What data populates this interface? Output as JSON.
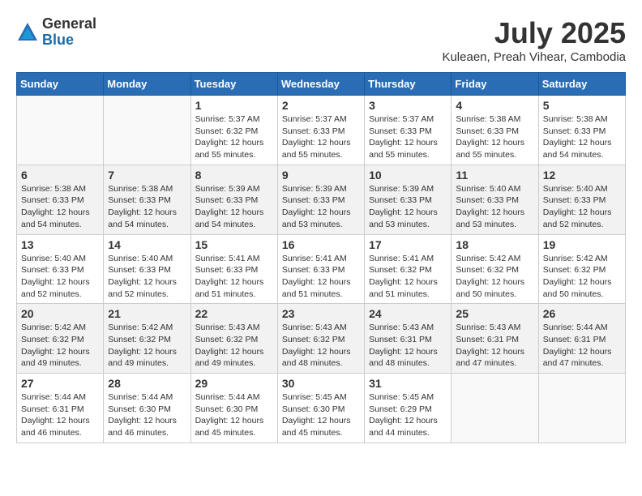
{
  "logo": {
    "general": "General",
    "blue": "Blue"
  },
  "title": "July 2025",
  "subtitle": "Kuleaen, Preah Vihear, Cambodia",
  "days_of_week": [
    "Sunday",
    "Monday",
    "Tuesday",
    "Wednesday",
    "Thursday",
    "Friday",
    "Saturday"
  ],
  "weeks": [
    [
      {
        "day": "",
        "info": ""
      },
      {
        "day": "",
        "info": ""
      },
      {
        "day": "1",
        "info": "Sunrise: 5:37 AM\nSunset: 6:32 PM\nDaylight: 12 hours\nand 55 minutes."
      },
      {
        "day": "2",
        "info": "Sunrise: 5:37 AM\nSunset: 6:33 PM\nDaylight: 12 hours\nand 55 minutes."
      },
      {
        "day": "3",
        "info": "Sunrise: 5:37 AM\nSunset: 6:33 PM\nDaylight: 12 hours\nand 55 minutes."
      },
      {
        "day": "4",
        "info": "Sunrise: 5:38 AM\nSunset: 6:33 PM\nDaylight: 12 hours\nand 55 minutes."
      },
      {
        "day": "5",
        "info": "Sunrise: 5:38 AM\nSunset: 6:33 PM\nDaylight: 12 hours\nand 54 minutes."
      }
    ],
    [
      {
        "day": "6",
        "info": "Sunrise: 5:38 AM\nSunset: 6:33 PM\nDaylight: 12 hours\nand 54 minutes."
      },
      {
        "day": "7",
        "info": "Sunrise: 5:38 AM\nSunset: 6:33 PM\nDaylight: 12 hours\nand 54 minutes."
      },
      {
        "day": "8",
        "info": "Sunrise: 5:39 AM\nSunset: 6:33 PM\nDaylight: 12 hours\nand 54 minutes."
      },
      {
        "day": "9",
        "info": "Sunrise: 5:39 AM\nSunset: 6:33 PM\nDaylight: 12 hours\nand 53 minutes."
      },
      {
        "day": "10",
        "info": "Sunrise: 5:39 AM\nSunset: 6:33 PM\nDaylight: 12 hours\nand 53 minutes."
      },
      {
        "day": "11",
        "info": "Sunrise: 5:40 AM\nSunset: 6:33 PM\nDaylight: 12 hours\nand 53 minutes."
      },
      {
        "day": "12",
        "info": "Sunrise: 5:40 AM\nSunset: 6:33 PM\nDaylight: 12 hours\nand 52 minutes."
      }
    ],
    [
      {
        "day": "13",
        "info": "Sunrise: 5:40 AM\nSunset: 6:33 PM\nDaylight: 12 hours\nand 52 minutes."
      },
      {
        "day": "14",
        "info": "Sunrise: 5:40 AM\nSunset: 6:33 PM\nDaylight: 12 hours\nand 52 minutes."
      },
      {
        "day": "15",
        "info": "Sunrise: 5:41 AM\nSunset: 6:33 PM\nDaylight: 12 hours\nand 51 minutes."
      },
      {
        "day": "16",
        "info": "Sunrise: 5:41 AM\nSunset: 6:33 PM\nDaylight: 12 hours\nand 51 minutes."
      },
      {
        "day": "17",
        "info": "Sunrise: 5:41 AM\nSunset: 6:32 PM\nDaylight: 12 hours\nand 51 minutes."
      },
      {
        "day": "18",
        "info": "Sunrise: 5:42 AM\nSunset: 6:32 PM\nDaylight: 12 hours\nand 50 minutes."
      },
      {
        "day": "19",
        "info": "Sunrise: 5:42 AM\nSunset: 6:32 PM\nDaylight: 12 hours\nand 50 minutes."
      }
    ],
    [
      {
        "day": "20",
        "info": "Sunrise: 5:42 AM\nSunset: 6:32 PM\nDaylight: 12 hours\nand 49 minutes."
      },
      {
        "day": "21",
        "info": "Sunrise: 5:42 AM\nSunset: 6:32 PM\nDaylight: 12 hours\nand 49 minutes."
      },
      {
        "day": "22",
        "info": "Sunrise: 5:43 AM\nSunset: 6:32 PM\nDaylight: 12 hours\nand 49 minutes."
      },
      {
        "day": "23",
        "info": "Sunrise: 5:43 AM\nSunset: 6:32 PM\nDaylight: 12 hours\nand 48 minutes."
      },
      {
        "day": "24",
        "info": "Sunrise: 5:43 AM\nSunset: 6:31 PM\nDaylight: 12 hours\nand 48 minutes."
      },
      {
        "day": "25",
        "info": "Sunrise: 5:43 AM\nSunset: 6:31 PM\nDaylight: 12 hours\nand 47 minutes."
      },
      {
        "day": "26",
        "info": "Sunrise: 5:44 AM\nSunset: 6:31 PM\nDaylight: 12 hours\nand 47 minutes."
      }
    ],
    [
      {
        "day": "27",
        "info": "Sunrise: 5:44 AM\nSunset: 6:31 PM\nDaylight: 12 hours\nand 46 minutes."
      },
      {
        "day": "28",
        "info": "Sunrise: 5:44 AM\nSunset: 6:30 PM\nDaylight: 12 hours\nand 46 minutes."
      },
      {
        "day": "29",
        "info": "Sunrise: 5:44 AM\nSunset: 6:30 PM\nDaylight: 12 hours\nand 45 minutes."
      },
      {
        "day": "30",
        "info": "Sunrise: 5:45 AM\nSunset: 6:30 PM\nDaylight: 12 hours\nand 45 minutes."
      },
      {
        "day": "31",
        "info": "Sunrise: 5:45 AM\nSunset: 6:29 PM\nDaylight: 12 hours\nand 44 minutes."
      },
      {
        "day": "",
        "info": ""
      },
      {
        "day": "",
        "info": ""
      }
    ]
  ]
}
